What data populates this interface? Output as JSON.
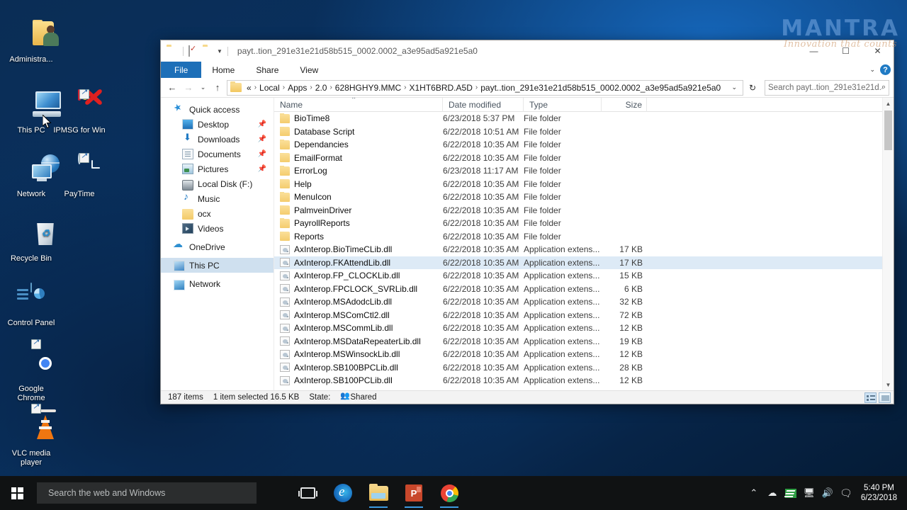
{
  "desktop": {
    "icons": [
      {
        "name": "Administra...",
        "icon": "user-folder-icon"
      },
      {
        "name": "This PC",
        "icon": "computer-icon"
      },
      {
        "name": "IPMSG for Win",
        "icon": "ipmsg-icon"
      },
      {
        "name": "Network",
        "icon": "network-icon"
      },
      {
        "name": "PayTime",
        "icon": "clock-icon"
      },
      {
        "name": "Recycle Bin",
        "icon": "recycle-bin-icon"
      },
      {
        "name": "Control Panel",
        "icon": "control-panel-icon"
      },
      {
        "name": "Google Chrome",
        "icon": "chrome-icon"
      },
      {
        "name": "VLC media player",
        "icon": "vlc-cone-icon"
      }
    ]
  },
  "watermark": {
    "main": "MANTRA",
    "sub": "Innovation that counts"
  },
  "explorer": {
    "title": "payt..tion_291e31e21d58b515_0002.0002_a3e95ad5a921e5a0",
    "window_buttons": {
      "minimize": "—",
      "maximize": "☐",
      "close": "✕"
    },
    "ribbon_tabs": [
      {
        "label": "File",
        "active": true
      },
      {
        "label": "Home",
        "active": false
      },
      {
        "label": "Share",
        "active": false
      },
      {
        "label": "View",
        "active": false
      }
    ],
    "help_icon_label": "?",
    "address": {
      "back_icon": "←",
      "forward_icon": "→",
      "recent_icon": "⌄",
      "up_icon": "↑",
      "prefix": "«",
      "crumbs": [
        "Local",
        "Apps",
        "2.0",
        "628HGHY9.MMC",
        "X1HT6BRD.A5D",
        "payt..tion_291e31e21d58b515_0002.0002_a3e95ad5a921e5a0"
      ],
      "dropdown_icon": "⌄",
      "refresh_icon": "↻"
    },
    "search": {
      "placeholder": "Search payt..tion_291e31e21d...",
      "icon": "search-icon"
    },
    "navpane": {
      "items": [
        {
          "label": "Quick access",
          "icon": "star-icon",
          "level": 0,
          "pinned": false,
          "selected": false
        },
        {
          "label": "Desktop",
          "icon": "desktop-icon",
          "level": 1,
          "pinned": true,
          "selected": false
        },
        {
          "label": "Downloads",
          "icon": "downloads-icon",
          "level": 1,
          "pinned": true,
          "selected": false
        },
        {
          "label": "Documents",
          "icon": "documents-icon",
          "level": 1,
          "pinned": true,
          "selected": false
        },
        {
          "label": "Pictures",
          "icon": "pictures-icon",
          "level": 1,
          "pinned": true,
          "selected": false
        },
        {
          "label": "Local Disk (F:)",
          "icon": "disk-icon",
          "level": 1,
          "pinned": false,
          "selected": false
        },
        {
          "label": "Music",
          "icon": "music-icon",
          "level": 1,
          "pinned": false,
          "selected": false
        },
        {
          "label": "ocx",
          "icon": "folder-icon",
          "level": 1,
          "pinned": false,
          "selected": false
        },
        {
          "label": "Videos",
          "icon": "videos-icon",
          "level": 1,
          "pinned": false,
          "selected": false
        },
        {
          "label": "OneDrive",
          "icon": "cloud-icon",
          "level": 0,
          "pinned": false,
          "selected": false
        },
        {
          "label": "This PC",
          "icon": "computer-icon",
          "level": 0,
          "pinned": false,
          "selected": true
        },
        {
          "label": "Network",
          "icon": "network-icon",
          "level": 0,
          "pinned": false,
          "selected": false
        }
      ]
    },
    "columns": [
      {
        "label": "Name",
        "sorted": "asc"
      },
      {
        "label": "Date modified",
        "sorted": null
      },
      {
        "label": "Type",
        "sorted": null
      },
      {
        "label": "Size",
        "sorted": null
      }
    ],
    "sort_caret": "⌃",
    "files": [
      {
        "name": "BioTime8",
        "date": "6/23/2018 5:37 PM",
        "type": "File folder",
        "size": "",
        "kind": "folder",
        "selected": false
      },
      {
        "name": "Database Script",
        "date": "6/22/2018 10:51 AM",
        "type": "File folder",
        "size": "",
        "kind": "folder",
        "selected": false
      },
      {
        "name": "Dependancies",
        "date": "6/22/2018 10:35 AM",
        "type": "File folder",
        "size": "",
        "kind": "folder",
        "selected": false
      },
      {
        "name": "EmailFormat",
        "date": "6/22/2018 10:35 AM",
        "type": "File folder",
        "size": "",
        "kind": "folder",
        "selected": false
      },
      {
        "name": "ErrorLog",
        "date": "6/23/2018 11:17 AM",
        "type": "File folder",
        "size": "",
        "kind": "folder",
        "selected": false
      },
      {
        "name": "Help",
        "date": "6/22/2018 10:35 AM",
        "type": "File folder",
        "size": "",
        "kind": "folder",
        "selected": false
      },
      {
        "name": "MenuIcon",
        "date": "6/22/2018 10:35 AM",
        "type": "File folder",
        "size": "",
        "kind": "folder",
        "selected": false
      },
      {
        "name": "PalmveinDriver",
        "date": "6/22/2018 10:35 AM",
        "type": "File folder",
        "size": "",
        "kind": "folder",
        "selected": false
      },
      {
        "name": "PayrollReports",
        "date": "6/22/2018 10:35 AM",
        "type": "File folder",
        "size": "",
        "kind": "folder",
        "selected": false
      },
      {
        "name": "Reports",
        "date": "6/22/2018 10:35 AM",
        "type": "File folder",
        "size": "",
        "kind": "folder",
        "selected": false
      },
      {
        "name": "AxInterop.BioTimeCLib.dll",
        "date": "6/22/2018 10:35 AM",
        "type": "Application extens...",
        "size": "17 KB",
        "kind": "dll",
        "selected": false
      },
      {
        "name": "AxInterop.FKAttendLib.dll",
        "date": "6/22/2018 10:35 AM",
        "type": "Application extens...",
        "size": "17 KB",
        "kind": "dll",
        "selected": true
      },
      {
        "name": "AxInterop.FP_CLOCKLib.dll",
        "date": "6/22/2018 10:35 AM",
        "type": "Application extens...",
        "size": "15 KB",
        "kind": "dll",
        "selected": false
      },
      {
        "name": "AxInterop.FPCLOCK_SVRLib.dll",
        "date": "6/22/2018 10:35 AM",
        "type": "Application extens...",
        "size": "6 KB",
        "kind": "dll",
        "selected": false
      },
      {
        "name": "AxInterop.MSAdodcLib.dll",
        "date": "6/22/2018 10:35 AM",
        "type": "Application extens...",
        "size": "32 KB",
        "kind": "dll",
        "selected": false
      },
      {
        "name": "AxInterop.MSComCtl2.dll",
        "date": "6/22/2018 10:35 AM",
        "type": "Application extens...",
        "size": "72 KB",
        "kind": "dll",
        "selected": false
      },
      {
        "name": "AxInterop.MSCommLib.dll",
        "date": "6/22/2018 10:35 AM",
        "type": "Application extens...",
        "size": "12 KB",
        "kind": "dll",
        "selected": false
      },
      {
        "name": "AxInterop.MSDataRepeaterLib.dll",
        "date": "6/22/2018 10:35 AM",
        "type": "Application extens...",
        "size": "19 KB",
        "kind": "dll",
        "selected": false
      },
      {
        "name": "AxInterop.MSWinsockLib.dll",
        "date": "6/22/2018 10:35 AM",
        "type": "Application extens...",
        "size": "12 KB",
        "kind": "dll",
        "selected": false
      },
      {
        "name": "AxInterop.SB100BPCLib.dll",
        "date": "6/22/2018 10:35 AM",
        "type": "Application extens...",
        "size": "28 KB",
        "kind": "dll",
        "selected": false
      },
      {
        "name": "AxInterop.SB100PCLib.dll",
        "date": "6/22/2018 10:35 AM",
        "type": "Application extens...",
        "size": "12 KB",
        "kind": "dll",
        "selected": false
      }
    ],
    "status": {
      "item_count": "187 items",
      "selection": "1 item selected  16.5 KB",
      "state_label": "State:",
      "state_value": "Shared"
    }
  },
  "taskbar": {
    "search_placeholder": "Search the web and Windows",
    "buttons": [
      {
        "name": "task-view",
        "label": ""
      },
      {
        "name": "edge",
        "label": ""
      },
      {
        "name": "file-explorer",
        "label": ""
      },
      {
        "name": "powerpoint",
        "label": "P"
      },
      {
        "name": "chrome",
        "label": ""
      }
    ],
    "tray": {
      "chevron": "⌃",
      "icons": [
        "onedrive-icon",
        "nvidia-icon",
        "network-icon",
        "volume-icon",
        "action-center-icon"
      ]
    },
    "clock": {
      "time": "5:40 PM",
      "date": "6/23/2018"
    }
  }
}
